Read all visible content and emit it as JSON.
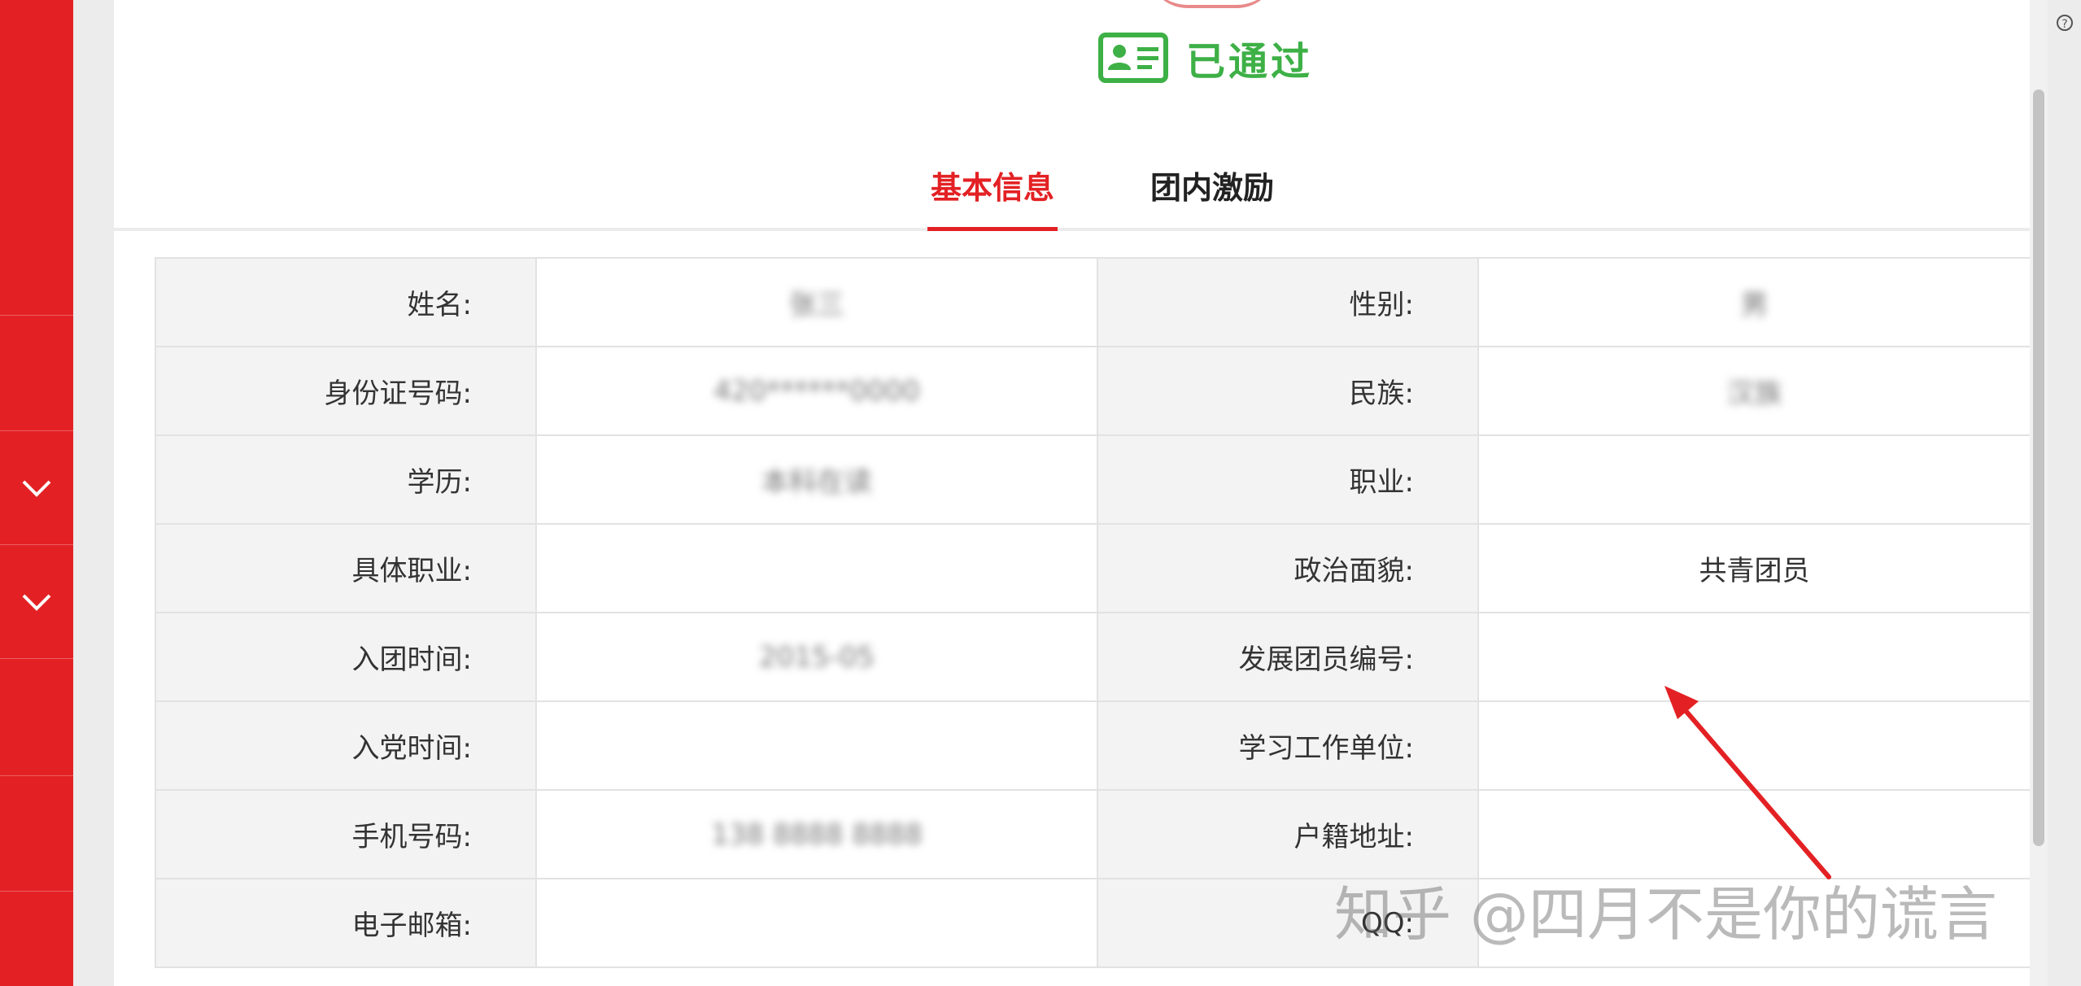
{
  "status": {
    "text": "已通过",
    "icon": "id-card-icon",
    "color": "#3db046"
  },
  "tabs": [
    {
      "label": "基本信息",
      "active": true
    },
    {
      "label": "团内激励",
      "active": false
    }
  ],
  "info": {
    "rows": [
      {
        "l1": "姓名:",
        "v1": "张三",
        "l2": "性别:",
        "v2": "男"
      },
      {
        "l1": "身份证号码:",
        "v1": "420******0000",
        "l2": "民族:",
        "v2": "汉族"
      },
      {
        "l1": "学历:",
        "v1": "本科在读",
        "l2": "职业:",
        "v2": ""
      },
      {
        "l1": "具体职业:",
        "v1": "",
        "l2": "政治面貌:",
        "v2": "共青团员"
      },
      {
        "l1": "入团时间:",
        "v1": "2015-05",
        "l2": "发展团员编号:",
        "v2": ""
      },
      {
        "l1": "入党时间:",
        "v1": "",
        "l2": "学习工作单位:",
        "v2": ""
      },
      {
        "l1": "手机号码:",
        "v1": "138 8888 8888",
        "l2": "户籍地址:",
        "v2": ""
      },
      {
        "l1": "电子邮箱:",
        "v1": "",
        "l2": "QQ:",
        "v2": ""
      }
    ]
  },
  "sidebar": {
    "icons": [
      "chevron-down-icon",
      "chevron-down-icon"
    ]
  },
  "watermark": "知乎 @四月不是你的谎言",
  "colors": {
    "brand_red": "#e32124",
    "success_green": "#3db046"
  }
}
